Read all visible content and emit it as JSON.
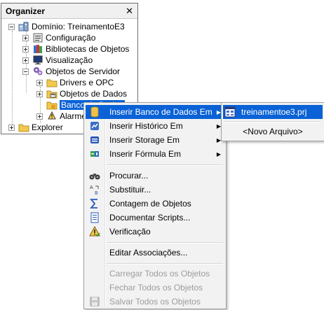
{
  "organizer": {
    "title": "Organizer",
    "close_glyph": "✕",
    "tree": [
      {
        "label": "Domínio: TreinamentoE3",
        "icon": "domain-icon",
        "expander": "minus"
      },
      {
        "label": "Configuração",
        "icon": "config-icon",
        "expander": "plus"
      },
      {
        "label": "Bibliotecas de Objetos",
        "icon": "library-icon",
        "expander": "plus"
      },
      {
        "label": "Visualização",
        "icon": "monitor-icon",
        "expander": "plus"
      },
      {
        "label": "Objetos de Servidor",
        "icon": "server-objects-icon",
        "expander": "minus"
      },
      {
        "label": "Drivers e OPC",
        "icon": "folder-icon",
        "expander": "plus"
      },
      {
        "label": "Objetos de Dados",
        "icon": "data-objects-icon",
        "expander": "plus"
      },
      {
        "label": "Banco de Dados",
        "icon": "database-folder-icon",
        "expander": "none",
        "selected": true
      },
      {
        "label": "Alarmes",
        "icon": "alarm-icon",
        "expander": "plus"
      },
      {
        "label": "Explorer",
        "icon": "folder-icon",
        "expander": "plus"
      }
    ]
  },
  "context_menu": {
    "items": [
      {
        "label": "Inserir Banco de Dados Em",
        "icon": "database-icon",
        "submenu": true,
        "highlighted": true
      },
      {
        "label": "Inserir Histórico Em",
        "icon": "historic-icon",
        "submenu": true
      },
      {
        "label": "Inserir Storage Em",
        "icon": "storage-icon",
        "submenu": true
      },
      {
        "label": "Inserir Fórmula Em",
        "icon": "formula-icon",
        "submenu": true
      },
      {
        "label": "Procurar...",
        "icon": "binoculars-icon"
      },
      {
        "label": "Substituir...",
        "icon": "replace-icon"
      },
      {
        "label": "Contagem de Objetos",
        "icon": "sigma-icon"
      },
      {
        "label": "Documentar Scripts...",
        "icon": "document-icon"
      },
      {
        "label": "Verificação",
        "icon": "warning-icon"
      },
      {
        "label": "Editar Associações..."
      },
      {
        "label": "Carregar Todos os Objetos",
        "disabled": true
      },
      {
        "label": "Fechar Todos os Objetos",
        "disabled": true
      },
      {
        "label": "Salvar Todos os Objetos",
        "icon": "save-icon",
        "disabled": true
      }
    ],
    "arrow_glyph": "▶"
  },
  "submenu": {
    "items": [
      {
        "label": "treinamentoe3.prj",
        "icon": "project-icon",
        "highlighted": true
      },
      {
        "label": "<Novo Arquivo>"
      }
    ]
  },
  "colors": {
    "selection": "#0a62d6",
    "menu_bg": "#f2f2f2",
    "disabled_text": "#9c9c9c"
  }
}
